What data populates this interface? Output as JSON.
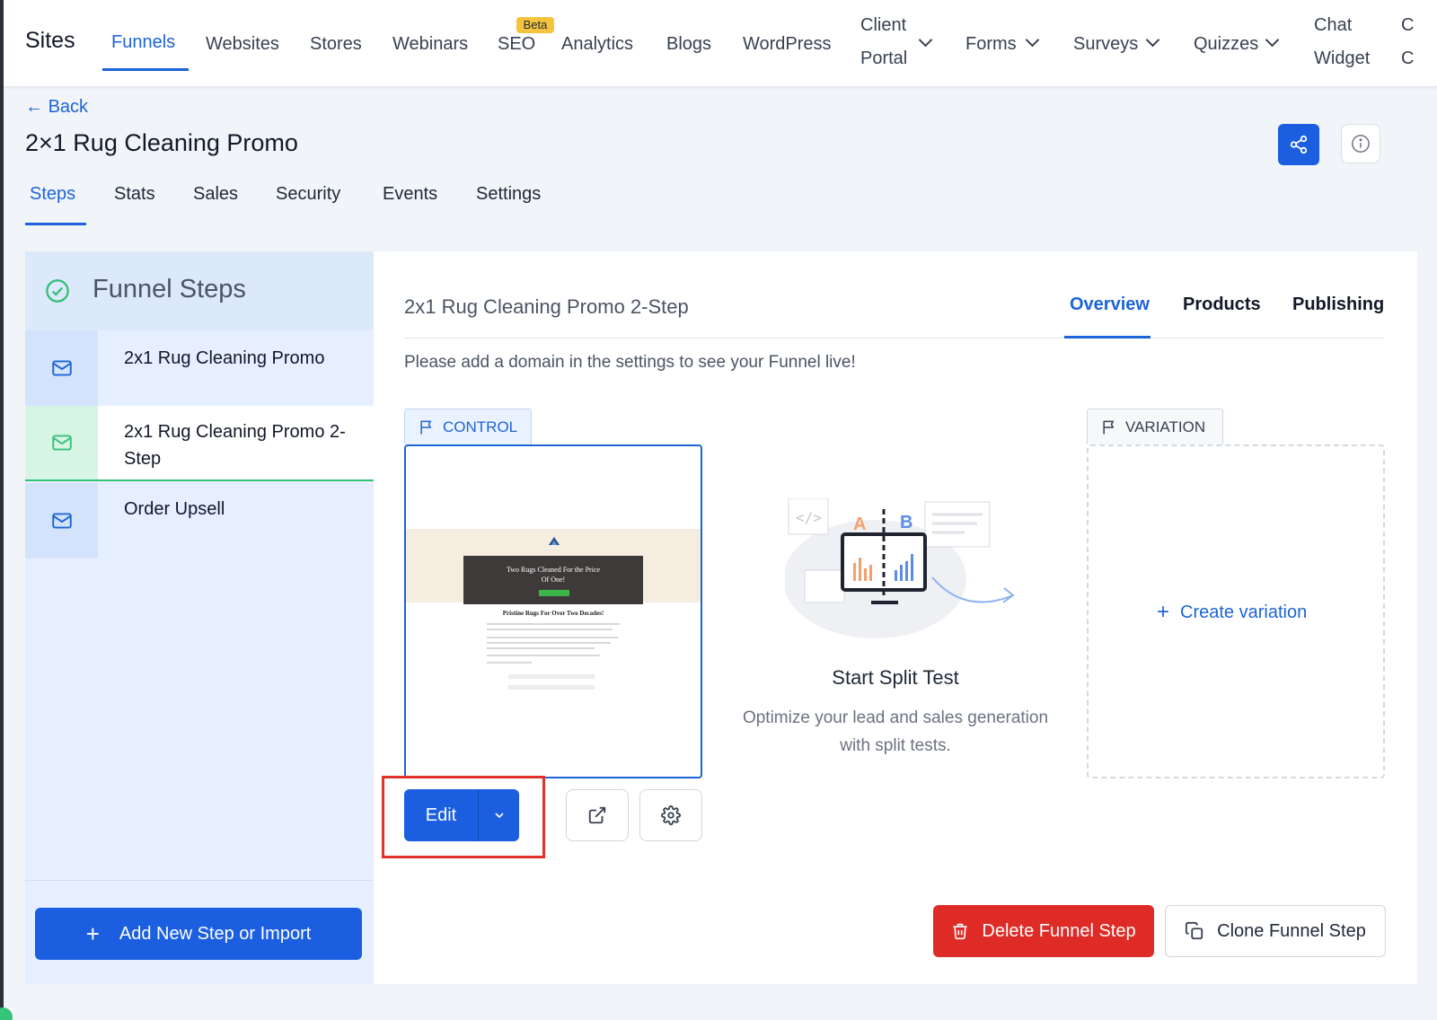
{
  "topnav": {
    "sites": "Sites",
    "items": [
      "Funnels",
      "Websites",
      "Stores",
      "Webinars",
      "SEO",
      "Analytics",
      "Blogs",
      "WordPress"
    ],
    "beta_badge": "Beta",
    "client_portal": [
      "Client",
      "Portal"
    ],
    "forms": "Forms",
    "surveys": "Surveys",
    "quizzes": "Quizzes",
    "chat_widget": [
      "Chat",
      "Widget"
    ],
    "overflow": [
      "C",
      "C"
    ]
  },
  "header": {
    "back": "Back",
    "title": "2×1 Rug Cleaning Promo"
  },
  "tabs": [
    "Steps",
    "Stats",
    "Sales",
    "Security",
    "Events",
    "Settings"
  ],
  "funnel_steps": {
    "title": "Funnel Steps",
    "steps": [
      {
        "label": "2x1 Rug Cleaning Promo"
      },
      {
        "label_line1": "2x1 Rug Cleaning Promo 2-",
        "label_line2": "Step"
      },
      {
        "label": "Order Upsell"
      }
    ],
    "add_button": "Add New Step or Import"
  },
  "main": {
    "title": "2x1 Rug Cleaning Promo 2-Step",
    "subtabs": [
      "Overview",
      "Products",
      "Publishing"
    ],
    "notice": "Please add a domain in the settings to see your Funnel live!",
    "control_tag": "CONTROL",
    "thumbnail": {
      "hero_text_line1": "Two Rugs Cleaned For the Price",
      "hero_text_line2": "Of One!",
      "heading": "Pristine Rugs For Over Two Decades!"
    },
    "edit_button": "Edit",
    "split_test": {
      "title": "Start Split Test",
      "description_line1": "Optimize your lead and sales generation",
      "description_line2": "with split tests.",
      "label_a": "A",
      "label_b": "B"
    },
    "variation_tag": "VARIATION",
    "create_variation": "Create variation",
    "delete_button": "Delete Funnel Step",
    "clone_button": "Clone Funnel Step"
  },
  "colors": {
    "accent": "#1b5fe0",
    "danger": "#df2b26",
    "success": "#34c17a",
    "highlight": "#e0312a"
  }
}
